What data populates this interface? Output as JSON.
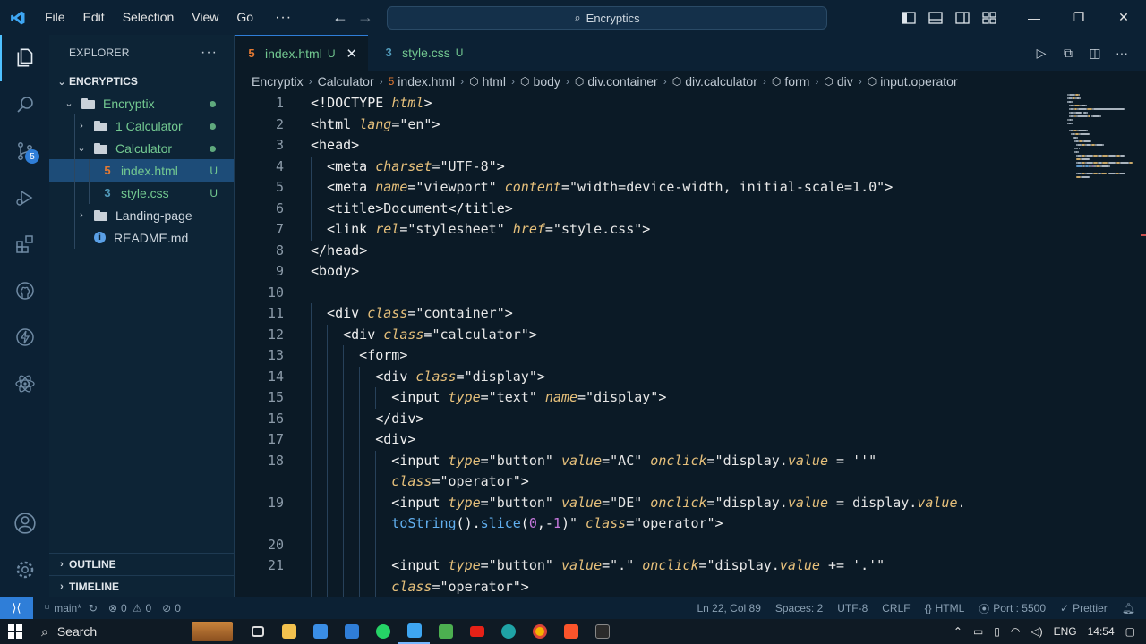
{
  "menu": [
    "File",
    "Edit",
    "Selection",
    "View",
    "Go"
  ],
  "menu_more": "···",
  "search": {
    "text": "Encryptics"
  },
  "sidebar": {
    "title": "EXPLORER",
    "more": "···",
    "root": "ENCRYPTICS",
    "items": [
      {
        "label": "Encryptix",
        "type": "folder",
        "depth": 1,
        "open": true,
        "status": "dot"
      },
      {
        "label": "1 Calculator",
        "type": "folder",
        "depth": 2,
        "open": false,
        "status": "dot"
      },
      {
        "label": "Calculator",
        "type": "folder",
        "depth": 2,
        "open": true,
        "status": "dot"
      },
      {
        "label": "index.html",
        "type": "html",
        "depth": 3,
        "status": "U",
        "selected": true
      },
      {
        "label": "style.css",
        "type": "css",
        "depth": 3,
        "status": "U"
      },
      {
        "label": "Landing-page",
        "type": "folder",
        "depth": 2,
        "open": false,
        "status": ""
      },
      {
        "label": "README.md",
        "type": "info",
        "depth": 2,
        "status": ""
      }
    ],
    "outline": "OUTLINE",
    "timeline": "TIMELINE"
  },
  "activity_badge": "5",
  "tabs": [
    {
      "label": "index.html",
      "mark": "U",
      "active": true,
      "close": "✕"
    },
    {
      "label": "style.css",
      "mark": "U",
      "active": false
    }
  ],
  "breadcrumb": [
    "Encryptix",
    "Calculator",
    "index.html",
    "html",
    "body",
    "div.container",
    "div.calculator",
    "form",
    "div",
    "input.operator"
  ],
  "code_lines": [
    {
      "n": "1",
      "indent": 0,
      "tokens": [
        [
          "pl",
          "<!"
        ],
        [
          "tg",
          "DOCTYPE "
        ],
        [
          "an",
          "html"
        ],
        [
          "pl",
          ">"
        ]
      ]
    },
    {
      "n": "2",
      "indent": 0,
      "tokens": [
        [
          "pl",
          "<"
        ],
        [
          "tg",
          "html "
        ],
        [
          "an",
          "lang"
        ],
        [
          "pl",
          "="
        ],
        [
          "av",
          "\"en\""
        ],
        [
          "pl",
          ">"
        ]
      ]
    },
    {
      "n": "3",
      "indent": 0,
      "tokens": [
        [
          "pl",
          "<"
        ],
        [
          "tg",
          "head"
        ],
        [
          "pl",
          ">"
        ]
      ]
    },
    {
      "n": "4",
      "indent": 1,
      "tokens": [
        [
          "pl",
          "<"
        ],
        [
          "tg",
          "meta "
        ],
        [
          "an",
          "charset"
        ],
        [
          "pl",
          "="
        ],
        [
          "av",
          "\"UTF-8\""
        ],
        [
          "pl",
          ">"
        ]
      ]
    },
    {
      "n": "5",
      "indent": 1,
      "tokens": [
        [
          "pl",
          "<"
        ],
        [
          "tg",
          "meta "
        ],
        [
          "an",
          "name"
        ],
        [
          "pl",
          "="
        ],
        [
          "av",
          "\"viewport\" "
        ],
        [
          "an",
          "content"
        ],
        [
          "pl",
          "="
        ],
        [
          "av",
          "\"width=device-width, initial-scale=1.0\""
        ],
        [
          "pl",
          ">"
        ]
      ]
    },
    {
      "n": "6",
      "indent": 1,
      "tokens": [
        [
          "pl",
          "<"
        ],
        [
          "tg",
          "title"
        ],
        [
          "pl",
          ">"
        ],
        [
          "av",
          "Document"
        ],
        [
          "pl",
          "</"
        ],
        [
          "tg",
          "title"
        ],
        [
          "pl",
          ">"
        ]
      ]
    },
    {
      "n": "7",
      "indent": 1,
      "tokens": [
        [
          "pl",
          "<"
        ],
        [
          "tg",
          "link "
        ],
        [
          "an",
          "rel"
        ],
        [
          "pl",
          "="
        ],
        [
          "av",
          "\"stylesheet\" "
        ],
        [
          "an",
          "href"
        ],
        [
          "pl",
          "="
        ],
        [
          "av",
          "\"style.css\""
        ],
        [
          "pl",
          ">"
        ]
      ]
    },
    {
      "n": "8",
      "indent": 0,
      "tokens": [
        [
          "pl",
          "</"
        ],
        [
          "tg",
          "head"
        ],
        [
          "pl",
          ">"
        ]
      ]
    },
    {
      "n": "9",
      "indent": 0,
      "tokens": [
        [
          "pl",
          "<"
        ],
        [
          "tg",
          "body"
        ],
        [
          "pl",
          ">"
        ]
      ]
    },
    {
      "n": "10",
      "indent": 0,
      "tokens": []
    },
    {
      "n": "11",
      "indent": 1,
      "tokens": [
        [
          "pl",
          "<"
        ],
        [
          "tg",
          "div "
        ],
        [
          "an",
          "class"
        ],
        [
          "pl",
          "="
        ],
        [
          "av",
          "\"container\""
        ],
        [
          "pl",
          ">"
        ]
      ]
    },
    {
      "n": "12",
      "indent": 2,
      "tokens": [
        [
          "pl",
          "<"
        ],
        [
          "tg",
          "div "
        ],
        [
          "an",
          "class"
        ],
        [
          "pl",
          "="
        ],
        [
          "av",
          "\"calculator\""
        ],
        [
          "pl",
          ">"
        ]
      ]
    },
    {
      "n": "13",
      "indent": 3,
      "tokens": [
        [
          "pl",
          "<"
        ],
        [
          "tg",
          "form"
        ],
        [
          "pl",
          ">"
        ]
      ]
    },
    {
      "n": "14",
      "indent": 4,
      "tokens": [
        [
          "pl",
          "<"
        ],
        [
          "tg",
          "div "
        ],
        [
          "an",
          "class"
        ],
        [
          "pl",
          "="
        ],
        [
          "av",
          "\"display\""
        ],
        [
          "pl",
          ">"
        ]
      ]
    },
    {
      "n": "15",
      "indent": 5,
      "tokens": [
        [
          "pl",
          "<"
        ],
        [
          "tg",
          "input "
        ],
        [
          "an",
          "type"
        ],
        [
          "pl",
          "="
        ],
        [
          "av",
          "\"text\" "
        ],
        [
          "an",
          "name"
        ],
        [
          "pl",
          "="
        ],
        [
          "av",
          "\"display\""
        ],
        [
          "pl",
          ">"
        ]
      ]
    },
    {
      "n": "16",
      "indent": 4,
      "tokens": [
        [
          "pl",
          "</"
        ],
        [
          "tg",
          "div"
        ],
        [
          "pl",
          ">"
        ]
      ]
    },
    {
      "n": "17",
      "indent": 4,
      "tokens": [
        [
          "pl",
          "<"
        ],
        [
          "tg",
          "div"
        ],
        [
          "pl",
          ">"
        ]
      ]
    },
    {
      "n": "18",
      "indent": 5,
      "tokens": [
        [
          "pl",
          "<"
        ],
        [
          "tg",
          "input "
        ],
        [
          "an",
          "type"
        ],
        [
          "pl",
          "="
        ],
        [
          "av",
          "\"button\" "
        ],
        [
          "an",
          "value"
        ],
        [
          "pl",
          "="
        ],
        [
          "av",
          "\"AC\" "
        ],
        [
          "an",
          "onclick"
        ],
        [
          "pl",
          "="
        ],
        [
          "av",
          "\"display."
        ],
        [
          "an",
          "value"
        ],
        [
          "av",
          " = ''\""
        ]
      ]
    },
    {
      "n": "",
      "indent": 5,
      "tokens": [
        [
          "an",
          "class"
        ],
        [
          "pl",
          "="
        ],
        [
          "av",
          "\"operator\""
        ],
        [
          "pl",
          ">"
        ]
      ]
    },
    {
      "n": "19",
      "indent": 5,
      "tokens": [
        [
          "pl",
          "<"
        ],
        [
          "tg",
          "input "
        ],
        [
          "an",
          "type"
        ],
        [
          "pl",
          "="
        ],
        [
          "av",
          "\"button\" "
        ],
        [
          "an",
          "value"
        ],
        [
          "pl",
          "="
        ],
        [
          "av",
          "\"DE\" "
        ],
        [
          "an",
          "onclick"
        ],
        [
          "pl",
          "="
        ],
        [
          "av",
          "\"display."
        ],
        [
          "an",
          "value"
        ],
        [
          "av",
          " = display."
        ],
        [
          "an",
          "value"
        ],
        [
          "av",
          "."
        ]
      ]
    },
    {
      "n": "",
      "indent": 5,
      "tokens": [
        [
          "fn",
          "toString"
        ],
        [
          "pl",
          "()."
        ],
        [
          "fn",
          "slice"
        ],
        [
          "pl",
          "("
        ],
        [
          "nm",
          "0"
        ],
        [
          "pl",
          ",-"
        ],
        [
          "nm",
          "1"
        ],
        [
          "pl",
          ")"
        ],
        [
          "av",
          "\" "
        ],
        [
          "an",
          "class"
        ],
        [
          "pl",
          "="
        ],
        [
          "av",
          "\"operator\""
        ],
        [
          "pl",
          ">"
        ]
      ]
    },
    {
      "n": "20",
      "indent": 5,
      "tokens": []
    },
    {
      "n": "21",
      "indent": 5,
      "tokens": [
        [
          "pl",
          "<"
        ],
        [
          "tg",
          "input "
        ],
        [
          "an",
          "type"
        ],
        [
          "pl",
          "="
        ],
        [
          "av",
          "\"button\" "
        ],
        [
          "an",
          "value"
        ],
        [
          "pl",
          "="
        ],
        [
          "av",
          "\".\" "
        ],
        [
          "an",
          "onclick"
        ],
        [
          "pl",
          "="
        ],
        [
          "av",
          "\"display."
        ],
        [
          "an",
          "value"
        ],
        [
          "av",
          " += '.'\""
        ]
      ]
    },
    {
      "n": "",
      "indent": 5,
      "tokens": [
        [
          "an",
          "class"
        ],
        [
          "pl",
          "="
        ],
        [
          "av",
          "\"operator\""
        ],
        [
          "pl",
          ">"
        ]
      ]
    }
  ],
  "status": {
    "branch": "main*",
    "errors": "0",
    "warnings": "0",
    "ports": "0",
    "position": "Ln 22, Col 89",
    "spaces": "Spaces: 2",
    "encoding": "UTF-8",
    "eol": "CRLF",
    "language": "HTML",
    "port": "Port : 5500",
    "prettier": "Prettier"
  },
  "taskbar": {
    "search": "Search",
    "lang": "ENG",
    "time": "14:54"
  },
  "colors": {
    "accent": "#2f7ed8",
    "modified": "#73c991",
    "html_icon": "#e37933",
    "css_icon": "#519aba"
  }
}
